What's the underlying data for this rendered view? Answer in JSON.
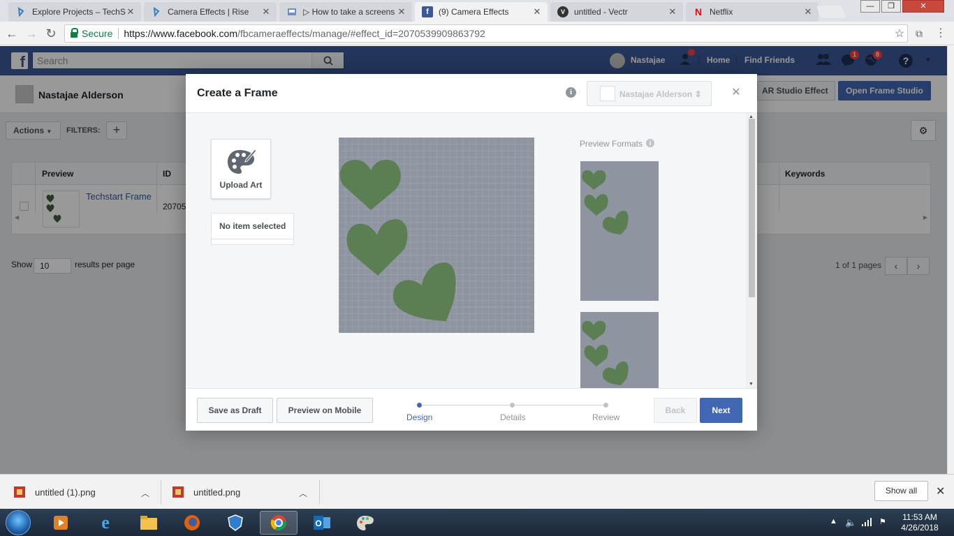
{
  "browser": {
    "tabs": [
      {
        "title": "Explore Projects – TechSt",
        "favicon": "techstart-icon",
        "active": false
      },
      {
        "title": "Camera Effects | Rise",
        "favicon": "techstart-icon",
        "active": false
      },
      {
        "title": "▷ How to take a screens",
        "favicon": "page-icon",
        "active": false
      },
      {
        "title": "(9) Camera Effects",
        "favicon": "facebook-icon",
        "active": true
      },
      {
        "title": "untitled - Vectr",
        "favicon": "vectr-icon",
        "active": false
      },
      {
        "title": "Netflix",
        "favicon": "netflix-icon",
        "active": false
      }
    ],
    "secure_label": "Secure",
    "url_host": "https://www.facebook.com",
    "url_path": "/fbcameraeffects/manage/#effect_id=2070539909863792"
  },
  "fb_header": {
    "search_placeholder": "Search",
    "user_name": "Nastajae",
    "home": "Home",
    "find_friends": "Find Friends",
    "messages_badge": "1",
    "notifications_badge": "8"
  },
  "manage_page": {
    "user_name": "Nastajae Alderson",
    "ar_studio_button": "AR Studio Effect",
    "open_frame_studio_button": "Open Frame Studio",
    "actions_label": "Actions",
    "filters_label": "FILTERS:",
    "table": {
      "columns": [
        "Preview",
        "ID",
        "Keywords"
      ],
      "rows": [
        {
          "name": "Techstart Frame",
          "id": "20705"
        }
      ]
    },
    "show_label": "Show",
    "per_page_value": "10",
    "results_label": "results per page",
    "pager_text": "1 of 1 pages"
  },
  "modal": {
    "title": "Create a Frame",
    "page_selector_name": "Nastajae Alderson",
    "upload_art_label": "Upload Art",
    "no_item_label": "No item selected",
    "preview_formats_label": "Preview Formats",
    "save_draft_button": "Save as Draft",
    "preview_mobile_button": "Preview on Mobile",
    "steps": [
      {
        "label": "Design",
        "active": true
      },
      {
        "label": "Details",
        "active": false
      },
      {
        "label": "Review",
        "active": false
      }
    ],
    "back_button": "Back",
    "next_button": "Next",
    "colors": {
      "heart": "#5b7f52",
      "canvas": "#8f95a0",
      "primary": "#4267b2"
    }
  },
  "downloads": {
    "items": [
      "untitled (1).png",
      "untitled.png"
    ],
    "show_all": "Show all"
  },
  "taskbar": {
    "time": "11:53 AM",
    "date": "4/26/2018"
  }
}
